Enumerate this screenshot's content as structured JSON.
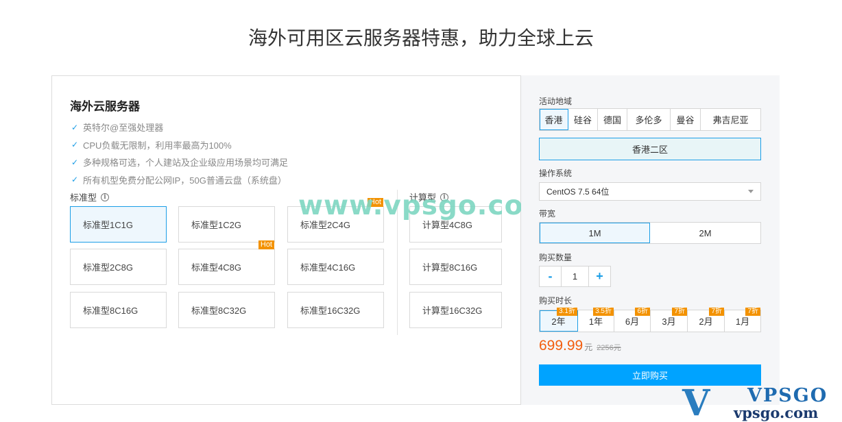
{
  "title": "海外可用区云服务器特惠，助力全球上云",
  "watermark": "www.vpsgo.com",
  "card": {
    "title": "海外云服务器",
    "features": [
      "英特尔@至强处理器",
      "CPU负载无限制，利用率最高为100%",
      "多种规格可选，个人建站及企业级应用场景均可满足",
      "所有机型免费分配公网IP，50G普通云盘（系统盘）"
    ],
    "standard_label": "标准型",
    "compute_label": "计算型",
    "info_icon": "i",
    "hot_badge": "Hot",
    "standard_specs": [
      "标准型1C1G",
      "标准型1C2G",
      "标准型2C4G",
      "标准型2C8G",
      "标准型4C8G",
      "标准型4C16G",
      "标准型8C16G",
      "标准型8C32G",
      "标准型16C32G"
    ],
    "compute_specs": [
      "计算型4C8G",
      "计算型8C16G",
      "计算型16C32G"
    ]
  },
  "panel": {
    "region_label": "活动地域",
    "regions": [
      "香港",
      "硅谷",
      "德国",
      "多伦多",
      "曼谷",
      "弗吉尼亚"
    ],
    "zone": "香港二区",
    "os_label": "操作系统",
    "os_value": "CentOS 7.5 64位",
    "bandwidth_label": "带宽",
    "bandwidth_options": [
      "1M",
      "2M"
    ],
    "quantity_label": "购买数量",
    "quantity_minus": "-",
    "quantity_value": "1",
    "quantity_plus": "+",
    "duration_label": "购买时长",
    "durations": [
      {
        "label": "2年",
        "discount": "3.1折"
      },
      {
        "label": "1年",
        "discount": "3.5折"
      },
      {
        "label": "6月",
        "discount": "6折"
      },
      {
        "label": "3月",
        "discount": "7折"
      },
      {
        "label": "2月",
        "discount": "7折"
      },
      {
        "label": "1月",
        "discount": "7折"
      }
    ],
    "price": "699.99",
    "price_unit": "元",
    "price_original": "2256元",
    "buy_button": "立即购买"
  },
  "logo": {
    "mark": "V",
    "name": "VPSGO",
    "url": "vpsgo.com"
  },
  "colors": {
    "accent": "#1a9de6",
    "buy": "#00a3ff",
    "hot": "#f39200",
    "price": "#f25d0e"
  }
}
